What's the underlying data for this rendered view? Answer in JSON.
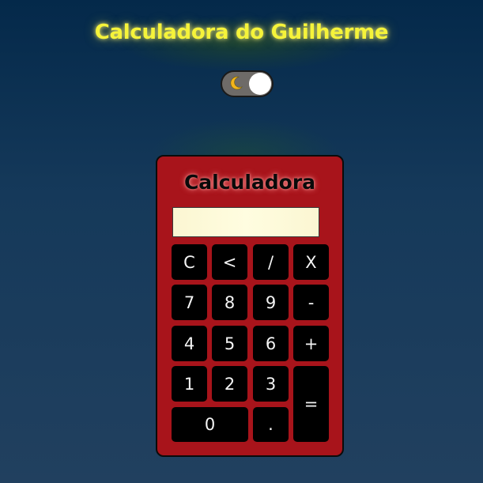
{
  "page": {
    "title": "Calculadora do Guilherme"
  },
  "theme_toggle": {
    "icon": "moon-icon",
    "state": "on"
  },
  "calculator": {
    "title": "Calculadora",
    "display_value": "",
    "keys": {
      "clear": "C",
      "backspace": "<",
      "divide": "/",
      "multiply": "X",
      "seven": "7",
      "eight": "8",
      "nine": "9",
      "minus": "-",
      "four": "4",
      "five": "5",
      "six": "6",
      "plus": "+",
      "one": "1",
      "two": "2",
      "three": "3",
      "equals": "=",
      "zero": "0",
      "decimal": "."
    }
  },
  "colors": {
    "title_text": "#f5f33a",
    "calculator_body": "#a8141b",
    "key_background": "#000000",
    "key_text": "#f4f4f4",
    "display_background": "#fffde0",
    "toggle_track": "#6e6b68",
    "moon": "#f2b51c"
  }
}
